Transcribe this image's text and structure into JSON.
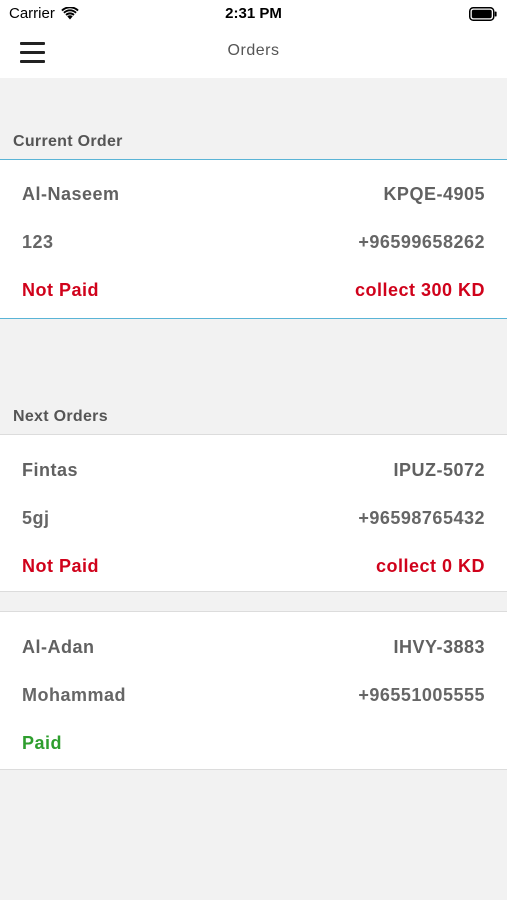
{
  "status_bar": {
    "carrier": "Carrier",
    "time": "2:31 PM",
    "wifi_icon": "wifi-icon",
    "battery_icon": "battery-icon"
  },
  "nav": {
    "title": "Orders",
    "menu_icon": "hamburger-menu-icon"
  },
  "current_section": {
    "label": "Current Order",
    "order": {
      "area": "Al-Naseem",
      "code": "KPQE-4905",
      "customer": "123",
      "phone": "+96599658262",
      "payment_status": "Not Paid",
      "collect": "collect 300 KD"
    }
  },
  "next_section": {
    "label": "Next Orders",
    "orders": [
      {
        "area": "Fintas",
        "code": "IPUZ-5072",
        "customer": "5gj",
        "phone": "+96598765432",
        "payment_status": "Not Paid",
        "collect": "collect 0 KD"
      },
      {
        "area": "Al-Adan",
        "code": "IHVY-3883",
        "customer": "Mohammad",
        "phone": "+96551005555",
        "payment_status": "Paid",
        "collect": ""
      }
    ]
  },
  "colors": {
    "accent_border": "#5ab4d6",
    "unpaid": "#d0021b",
    "paid": "#2e9e2e",
    "background": "#f2f2f2"
  }
}
